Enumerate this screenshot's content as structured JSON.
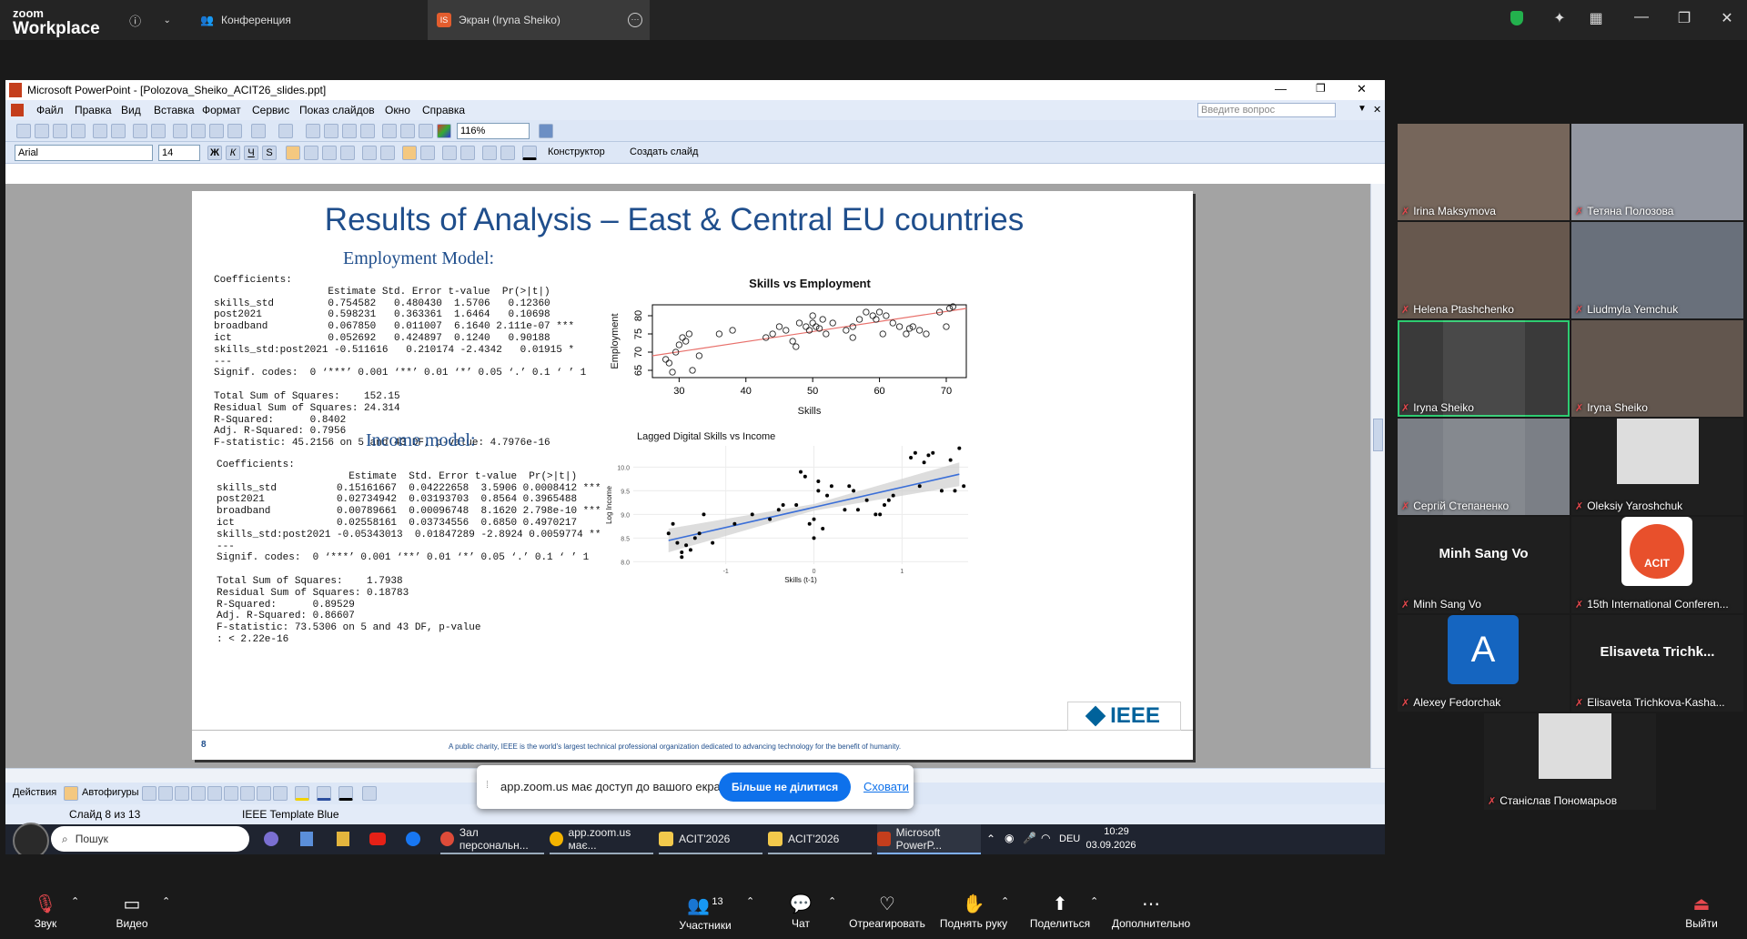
{
  "zoom": {
    "logo_top": "zoom",
    "logo_bottom": "Workplace",
    "tab_meeting": "Конференция",
    "tab_screen": "Экран (Iryna Sheiko)",
    "tab_screen_avatar": "IS"
  },
  "ppt": {
    "window_title": "Microsoft PowerPoint - [Polozova_Sheiko_ACIT26_slides.ppt]",
    "menu": [
      "Файл",
      "Правка",
      "Вид",
      "Вставка",
      "Формат",
      "Сервис",
      "Показ слайдов",
      "Окно",
      "Справка"
    ],
    "ask_placeholder": "Введите вопрос",
    "zoom_level": "116%",
    "font_name": "Arial",
    "font_size": "14",
    "designer_button": "Конструктор",
    "new_slide_button": "Создать слайд",
    "actions_menu": "Действия",
    "autoshapes_menu": "Автофигуры",
    "status_slide": "Слайд 8 из 13",
    "status_template": "IEEE Template Blue"
  },
  "slide": {
    "title": "Results of Analysis – East & Central EU countries",
    "employment_heading": "Employment Model:",
    "income_heading": "Income model:",
    "employment_output": "Coefficients:\n                   Estimate Std. Error t-value  Pr(>|t|)\nskills_std         0.754582   0.480430  1.5706   0.12360\npost2021           0.598231   0.363361  1.6464   0.10698\nbroadband          0.067850   0.011007  6.1640 2.111e-07 ***\nict                0.052692   0.424897  0.1240   0.90188\nskills_std:post2021 -0.511616   0.210174 -2.4342   0.01915 *\n---\nSignif. codes:  0 ‘***’ 0.001 ‘**’ 0.01 ‘*’ 0.05 ‘.’ 0.1 ‘ ’ 1\n\nTotal Sum of Squares:    152.15\nResidual Sum of Squares: 24.314\nR-Squared:      0.8402\nAdj. R-Squared: 0.7956\nF-statistic: 45.2156 on 5 and 43 DF, p-value: 4.7976e-16",
    "income_output": "Coefficients:\n                      Estimate  Std. Error t-value  Pr(>|t|)\nskills_std          0.15161667  0.04222658  3.5906 0.0008412 ***\npost2021            0.02734942  0.03193703  0.8564 0.3965488\nbroadband           0.00789661  0.00096748  8.1620 2.798e-10 ***\nict                 0.02558161  0.03734556  0.6850 0.4970217\nskills_std:post2021 -0.05343013  0.01847289 -2.8924 0.0059774 **\n---\nSignif. codes:  0 ‘***’ 0.001 ‘**’ 0.01 ‘*’ 0.05 ‘.’ 0.1 ‘ ’ 1\n\nTotal Sum of Squares:    1.7938\nResidual Sum of Squares: 0.18783\nR-Squared:      0.89529\nAdj. R-Squared: 0.86607\nF-statistic: 73.5306 on 5 and 43 DF, p-value\n: < 2.22e-16",
    "slide_number": "8",
    "footer_text": "A public charity, IEEE is the world's largest technical professional organization dedicated to advancing technology for the benefit of humanity.",
    "ieee_logo": "IEEE"
  },
  "chart_data": [
    {
      "type": "scatter",
      "title": "Skills vs Employment",
      "xlabel": "Skills",
      "ylabel": "Employment",
      "xlim": [
        26,
        73
      ],
      "ylim": [
        63,
        83
      ],
      "xticks": [
        30,
        40,
        50,
        60,
        70
      ],
      "yticks": [
        65,
        70,
        75,
        80
      ],
      "marker": "open-circle",
      "fit_line_color": "#e8706b",
      "fit": {
        "x": [
          26,
          73
        ],
        "y": [
          69.0,
          82.0
        ]
      },
      "points": {
        "x": [
          28,
          28.5,
          29,
          29.5,
          30,
          30.5,
          31,
          31.5,
          32,
          33,
          36,
          38,
          43,
          44,
          45,
          46,
          47,
          47.5,
          48,
          49,
          49.5,
          50,
          50,
          50.5,
          51,
          51.5,
          52,
          53,
          55,
          56,
          56,
          57,
          58,
          59,
          59.5,
          60,
          60.5,
          61,
          62,
          63,
          64,
          64.5,
          65,
          66,
          67,
          69,
          70,
          70.5,
          71
        ],
        "y": [
          68,
          67,
          64.5,
          70,
          72,
          74,
          73,
          75,
          65,
          69,
          75,
          76,
          74,
          75,
          77,
          76,
          73,
          71.5,
          78,
          77,
          76,
          78,
          80,
          77,
          76.5,
          79,
          75,
          78,
          76,
          77,
          74,
          79,
          81,
          80,
          79,
          81,
          75,
          80,
          78,
          77,
          75,
          76.5,
          77,
          76,
          75,
          81,
          77,
          82,
          82.5
        ]
      }
    },
    {
      "type": "scatter",
      "title": "Lagged Digital Skills vs Income",
      "xlabel": "Skills (t-1)",
      "ylabel": "Log Income",
      "xlim": [
        -2.05,
        1.75
      ],
      "ylim": [
        7.95,
        10.45
      ],
      "xticks": [
        -1,
        0,
        1
      ],
      "yticks": [
        8.0,
        8.5,
        9.0,
        9.5,
        10.0
      ],
      "marker": "filled-dot",
      "fit_line_color": "#3b6fd8",
      "band_color": "#cfcfcf",
      "fit": {
        "x": [
          -1.65,
          1.65
        ],
        "y": [
          8.45,
          9.85
        ]
      },
      "points": {
        "x": [
          -1.65,
          -1.6,
          -1.55,
          -1.5,
          -1.5,
          -1.45,
          -1.4,
          -1.35,
          -1.3,
          -1.25,
          -1.15,
          -0.9,
          -0.7,
          -0.5,
          -0.4,
          -0.35,
          -0.2,
          -0.15,
          -0.1,
          -0.05,
          0,
          0,
          0.05,
          0.05,
          0.1,
          0.15,
          0.2,
          0.35,
          0.4,
          0.45,
          0.5,
          0.6,
          0.7,
          0.75,
          0.8,
          0.85,
          0.9,
          1.1,
          1.15,
          1.2,
          1.25,
          1.3,
          1.35,
          1.45,
          1.55,
          1.6,
          1.65,
          1.7
        ],
        "y": [
          8.6,
          8.8,
          8.4,
          8.2,
          8.1,
          8.35,
          8.25,
          8.5,
          8.6,
          9.0,
          8.4,
          8.8,
          9.0,
          8.9,
          9.1,
          9.2,
          9.2,
          9.9,
          9.8,
          8.8,
          8.5,
          8.9,
          9.7,
          9.5,
          8.7,
          9.4,
          9.6,
          9.1,
          9.6,
          9.5,
          9.1,
          9.3,
          9.0,
          9.0,
          9.2,
          9.3,
          9.4,
          10.2,
          10.3,
          9.6,
          10.1,
          10.25,
          10.3,
          9.5,
          10.15,
          9.5,
          10.4,
          9.6
        ]
      }
    }
  ],
  "taskbar": {
    "search": "Пошук",
    "items": [
      "Зал персональн...",
      "app.zoom.us має...",
      "ACIT'2026",
      "ACIT'2026",
      "Microsoft PowerP..."
    ],
    "lang": "DEU",
    "time": "10:29",
    "date": "03.09.2026"
  },
  "share_notice": {
    "text": "app.zoom.us має доступ до вашого екрана.",
    "stop_button": "Більше не ділитися",
    "hide_link": "Сховати"
  },
  "participants": [
    {
      "name": "Irina Maksymova"
    },
    {
      "name": "Тетяна Полозова"
    },
    {
      "name": "Helena Ptashchenko"
    },
    {
      "name": "Liudmyla Yemchuk"
    },
    {
      "name": "Iryna Sheiko"
    },
    {
      "name": "Iryna Sheiko"
    },
    {
      "name": "Сергій Степаненко"
    },
    {
      "name": "Oleksiy Yaroshchuk"
    },
    {
      "name": "Minh Sang Vo",
      "display": "Minh Sang Vo"
    },
    {
      "name": "15th International Conferen...",
      "badge": "ACIT"
    },
    {
      "name": "Alexey Fedorchak",
      "avatar_letter": "A"
    },
    {
      "name": "Elisaveta Trichkova-Kasha...",
      "display": "Elisaveta  Trichk..."
    },
    {
      "name": "Станіслав Пономарьов"
    }
  ],
  "controls": {
    "audio": "Звук",
    "video": "Видео",
    "participants": "Участники",
    "participants_count": "13",
    "chat": "Чат",
    "react": "Отреагировать",
    "raise_hand": "Поднять руку",
    "share": "Поделиться",
    "more": "Дополнительно",
    "leave": "Выйти"
  }
}
